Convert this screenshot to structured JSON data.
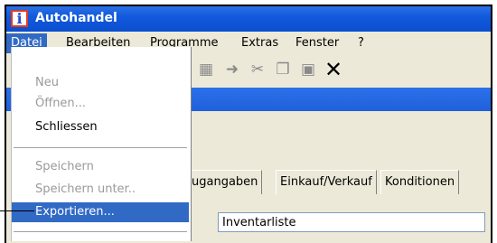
{
  "window": {
    "title": "Autohandel",
    "icon_letter": "i"
  },
  "menubar": {
    "items": [
      "Datei",
      "Bearbeiten",
      "Programme",
      "Extras",
      "Fenster",
      "?"
    ],
    "active": "Datei"
  },
  "file_menu": {
    "items": [
      {
        "label": "Neu",
        "enabled": false
      },
      {
        "label": "Öffnen...",
        "enabled": false
      },
      {
        "label": "Schliessen",
        "enabled": true
      },
      {
        "label": "Speichern",
        "enabled": false
      },
      {
        "label": "Speichern unter..",
        "enabled": false
      },
      {
        "label": "Exportieren...",
        "enabled": true,
        "highlighted": true
      }
    ]
  },
  "tabs": [
    "ugangaben",
    "Einkauf/Verkauf",
    "Konditionen"
  ],
  "field": {
    "value": "Inventarliste"
  },
  "colors": {
    "titlebar": "#1259dc",
    "highlight": "#316ac5"
  }
}
